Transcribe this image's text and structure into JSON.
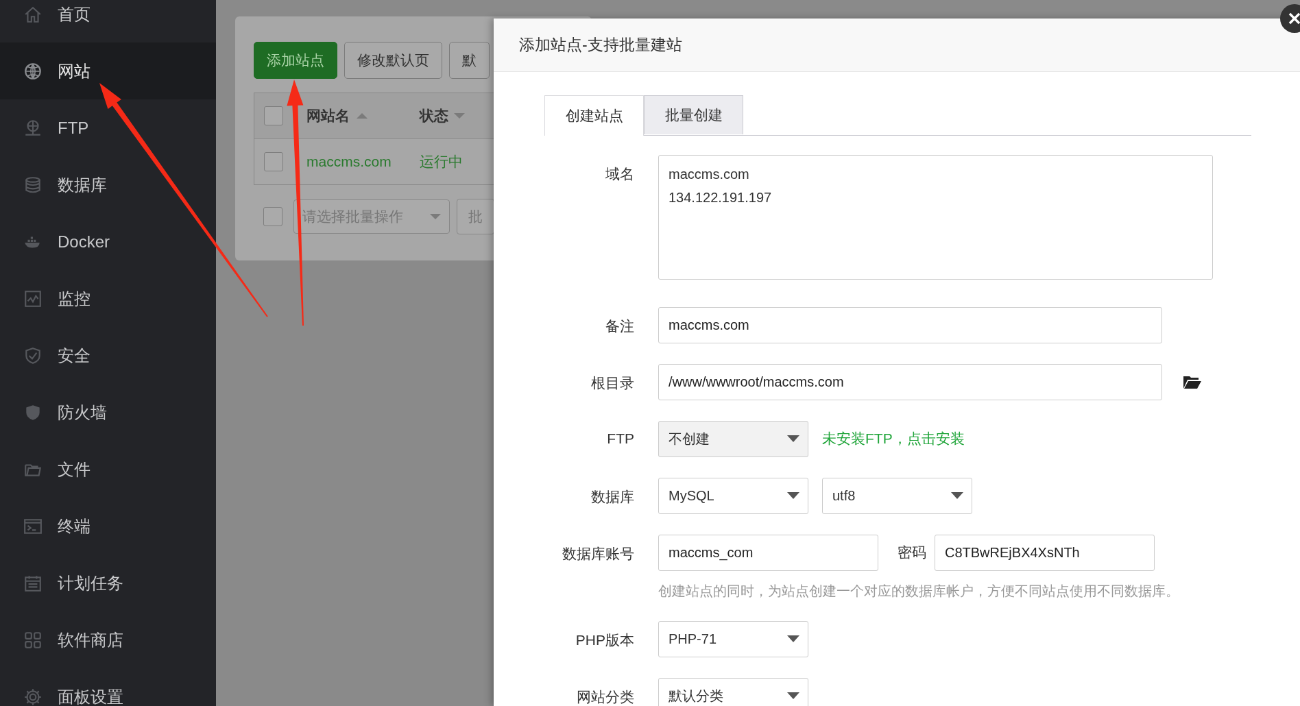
{
  "sidebar": {
    "items": [
      {
        "label": "首页",
        "selected": false
      },
      {
        "label": "网站",
        "selected": true
      },
      {
        "label": "FTP",
        "selected": false
      },
      {
        "label": "数据库",
        "selected": false
      },
      {
        "label": "Docker",
        "selected": false
      },
      {
        "label": "监控",
        "selected": false
      },
      {
        "label": "安全",
        "selected": false
      },
      {
        "label": "防火墙",
        "selected": false
      },
      {
        "label": "文件",
        "selected": false
      },
      {
        "label": "终端",
        "selected": false
      },
      {
        "label": "计划任务",
        "selected": false
      },
      {
        "label": "软件商店",
        "selected": false
      },
      {
        "label": "面板设置",
        "selected": false
      }
    ]
  },
  "site_list": {
    "buttons": [
      {
        "label": "添加站点",
        "primary": true
      },
      {
        "label": "修改默认页",
        "primary": false
      },
      {
        "label": "默",
        "primary": false
      }
    ],
    "table": {
      "header_checked": false,
      "columns": [
        {
          "label": "网站名",
          "ascending": true
        },
        {
          "label": "状态",
          "ascending": false
        }
      ],
      "rows": [
        {
          "checked": false,
          "name": "maccms.com",
          "status": "运行中"
        }
      ]
    },
    "batch": {
      "checked": false,
      "placeholder": "请选择批量操作",
      "button": "批"
    }
  },
  "dialog": {
    "title": "添加站点-支持批量建站",
    "tabs": [
      {
        "label": "创建站点",
        "selected": true
      },
      {
        "label": "批量创建",
        "selected": false
      }
    ],
    "rows": [
      {
        "label": "域名",
        "controls": [
          {
            "kind": "textarea",
            "lines": [
              "maccms.com",
              "134.122.191.197"
            ]
          }
        ]
      },
      {
        "label": "备注",
        "controls": [
          {
            "kind": "input",
            "value": "maccms.com"
          }
        ]
      },
      {
        "label": "根目录",
        "controls": [
          {
            "kind": "input",
            "value": "/www/wwwroot/maccms.com"
          },
          {
            "kind": "folder"
          }
        ]
      },
      {
        "label": "FTP",
        "controls": [
          {
            "kind": "select",
            "value": "不创建",
            "disabled": true
          },
          {
            "kind": "link",
            "text": "未安装FTP，点击安装"
          }
        ]
      },
      {
        "label": "数据库",
        "controls": [
          {
            "kind": "select",
            "value": "MySQL",
            "disabled": false
          },
          {
            "kind": "select",
            "value": "utf8",
            "disabled": false
          }
        ]
      },
      {
        "label": "数据库账号",
        "controls": [
          {
            "kind": "input",
            "value": "maccms_com"
          },
          {
            "kind": "label",
            "text": "密码"
          },
          {
            "kind": "input",
            "value": "C8TBwREjBX4XsNTh"
          }
        ],
        "hint": "创建站点的同时，为站点创建一个对应的数据库帐户，方便不同站点使用不同数据库。"
      },
      {
        "label": "PHP版本",
        "controls": [
          {
            "kind": "select",
            "value": "PHP-71",
            "disabled": false
          }
        ]
      },
      {
        "label": "网站分类",
        "controls": [
          {
            "kind": "select",
            "value": "默认分类",
            "disabled": false
          }
        ]
      }
    ]
  }
}
